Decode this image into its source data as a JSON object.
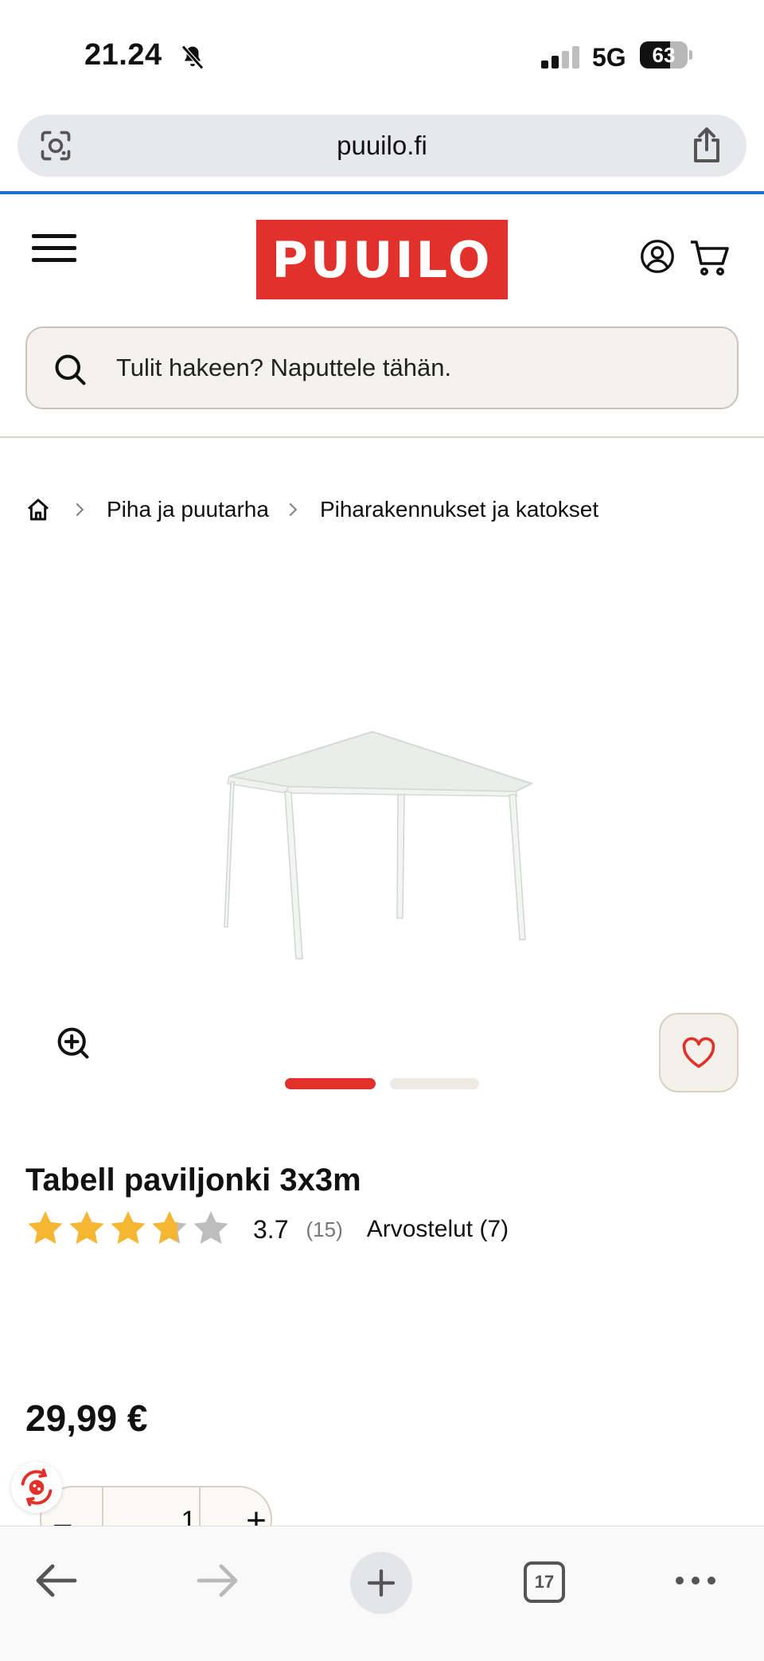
{
  "status_bar": {
    "time": "21.24",
    "network": "5G",
    "battery": "63",
    "battery_level": 0.63
  },
  "browser": {
    "url": "puuilo.fi",
    "open_tabs": "17"
  },
  "site": {
    "logo_text": "PUUILO",
    "search_placeholder": "Tulit hakeen? Naputtele tähän.",
    "brand_color": "#e2302b"
  },
  "breadcrumb": {
    "items": [
      "Piha ja puutarha",
      "Piharakennukset ja katokset"
    ]
  },
  "product": {
    "title": "Tabell paviljonki 3x3m",
    "rating_value": "3.7",
    "rating_stars": 3.7,
    "rating_count": "(15)",
    "reviews_label": "Arvostelut (7)",
    "price": "29,99 €",
    "quantity": "1",
    "minus_label": "−",
    "plus_label": "+",
    "image_count": 2,
    "active_image": 1
  },
  "icons": {
    "status": [
      "bell-off-icon",
      "signal-icon",
      "battery-icon"
    ],
    "browser": [
      "lens-icon",
      "share-icon",
      "back-icon",
      "forward-icon",
      "new-tab-icon",
      "tabs-icon",
      "more-icon"
    ],
    "site": [
      "menu-icon",
      "account-icon",
      "cart-icon",
      "search-icon",
      "home-icon",
      "zoom-icon",
      "heart-icon",
      "cookie-icon"
    ]
  }
}
